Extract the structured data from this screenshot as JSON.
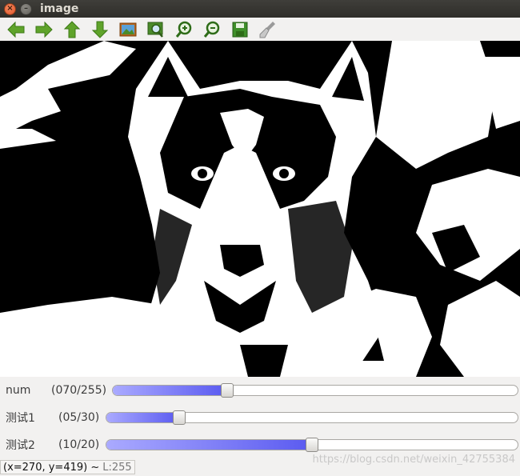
{
  "window": {
    "title": "image"
  },
  "toolbar": {
    "buttons": [
      {
        "icon": "arrow-left-icon"
      },
      {
        "icon": "arrow-right-icon"
      },
      {
        "icon": "arrow-up-icon"
      },
      {
        "icon": "arrow-down-icon"
      },
      {
        "icon": "fit-image-icon"
      },
      {
        "icon": "zoom-region-icon"
      },
      {
        "icon": "zoom-in-icon"
      },
      {
        "icon": "zoom-out-icon"
      },
      {
        "icon": "save-icon"
      },
      {
        "icon": "properties-brush-icon"
      }
    ]
  },
  "trackbars": [
    {
      "label": "num",
      "value_text": "(070/255)",
      "fraction": 0.2745
    },
    {
      "label": "测试1",
      "value_text": "(05/30)",
      "fraction": 0.1667
    },
    {
      "label": "测试2",
      "value_text": "(10/20)",
      "fraction": 0.5
    }
  ],
  "status": {
    "coords": "(x=270, y=419) ~",
    "luminance": "L:255"
  },
  "watermark": "https://blog.csdn.net/weixin_42755384",
  "colors": {
    "accent": "#6b6bf5",
    "titlebar": "#3c3b37",
    "close": "#e95420"
  }
}
